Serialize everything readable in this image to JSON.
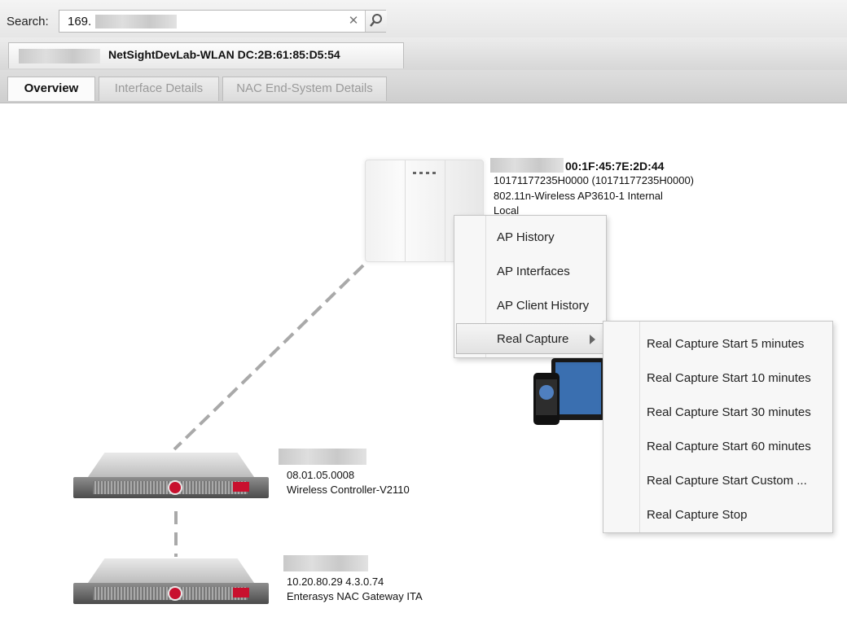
{
  "search": {
    "label": "Search:",
    "value": "169.",
    "clear_icon": "close-icon",
    "go_icon": "search-icon"
  },
  "device_tab": {
    "title": "NetSightDevLab-WLAN DC:2B:61:85:D5:54"
  },
  "tabs": [
    {
      "label": "Overview",
      "active": true
    },
    {
      "label": "Interface Details",
      "active": false
    },
    {
      "label": "NAC End-System Details",
      "active": false
    }
  ],
  "ap": {
    "mac": "00:1F:45:7E:2D:44",
    "serial": "10171177235H0000 (10171177235H0000)",
    "model": "802.11n-Wireless AP3610-1 Internal",
    "mode": "Local"
  },
  "controller": {
    "version": "08.01.05.0008",
    "name": "Wireless Controller-V2110"
  },
  "gateway": {
    "address": "10.20.80.29 4.3.0.74",
    "name": "Enterasys NAC Gateway ITA"
  },
  "context_menu": {
    "items": [
      {
        "label": "AP History"
      },
      {
        "label": "AP Interfaces"
      },
      {
        "label": "AP Client History"
      },
      {
        "label": "Real Capture",
        "has_submenu": true
      }
    ]
  },
  "submenu": {
    "items": [
      {
        "label": "Real Capture Start 5 minutes"
      },
      {
        "label": "Real Capture Start 10 minutes"
      },
      {
        "label": "Real Capture Start 30 minutes"
      },
      {
        "label": "Real Capture Start 60 minutes"
      },
      {
        "label": "Real Capture Start Custom ..."
      },
      {
        "label": "Real Capture Stop"
      }
    ]
  },
  "colors": {
    "accent_red": "#c8102e",
    "link_line": "#a9a9a9"
  }
}
